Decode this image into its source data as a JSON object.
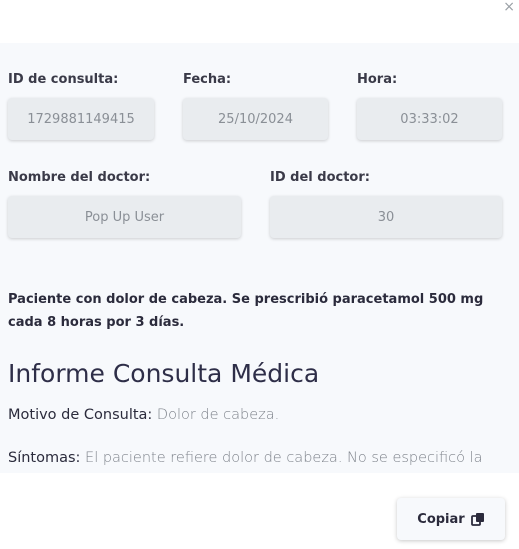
{
  "dialog": {
    "close_symbol": "×"
  },
  "form": {
    "consulta_id_label": "ID de consulta:",
    "consulta_id_value": "1729881149415",
    "fecha_label": "Fecha:",
    "fecha_value": "25/10/2024",
    "hora_label": "Hora:",
    "hora_value": "03:33:02",
    "doctor_name_label": "Nombre del doctor:",
    "doctor_name_value": "Pop Up User",
    "doctor_id_label": "ID del doctor:",
    "doctor_id_value": "30"
  },
  "notes": "Paciente con dolor de cabeza. Se prescribió paracetamol 500 mg cada 8 horas por 3 días.",
  "report": {
    "title": "Informe Consulta Médica",
    "motivo_label": "Motivo de Consulta:",
    "motivo_value": "Dolor de cabeza.",
    "sintomas_label": "Síntomas:",
    "sintomas_value": "El paciente refiere dolor de cabeza. No se especificó la"
  },
  "actions": {
    "copy_label": "Copiar",
    "copy_icon": "copy-icon"
  }
}
